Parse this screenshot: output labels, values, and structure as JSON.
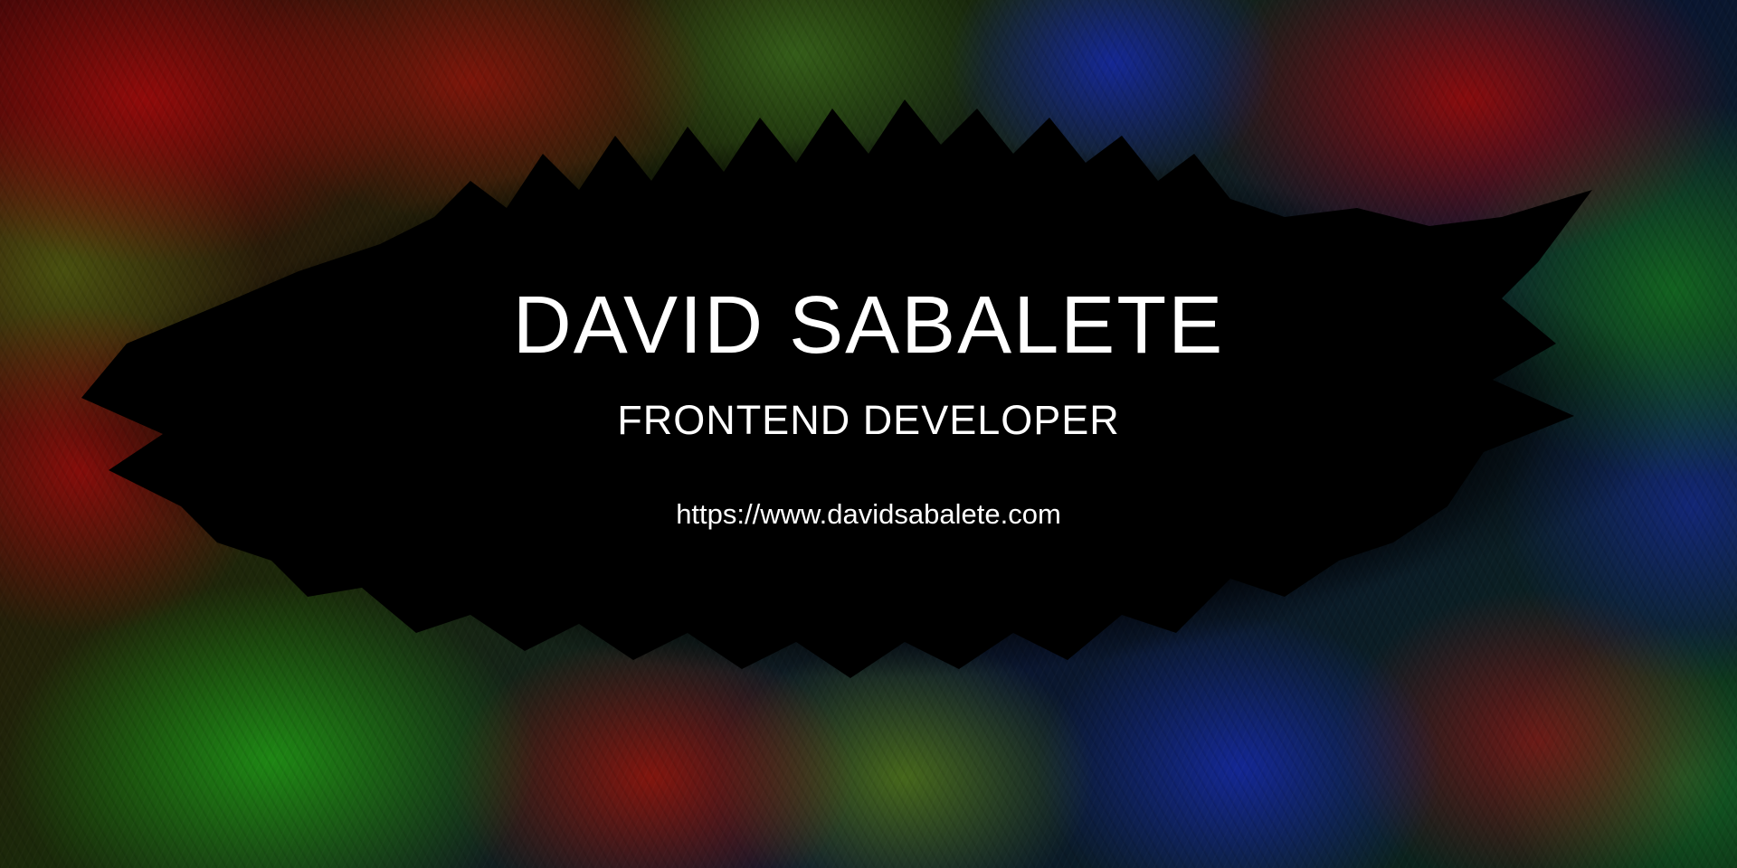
{
  "hero": {
    "name": "DAVID SABALETE",
    "role": "FRONTEND DEVELOPER",
    "website": "https://www.davidsabalete.com"
  },
  "colors": {
    "text": "#ffffff",
    "background": "#000000",
    "paint_red": "#960a0a",
    "paint_green": "#1e8c14",
    "paint_blue": "#1428aa"
  }
}
